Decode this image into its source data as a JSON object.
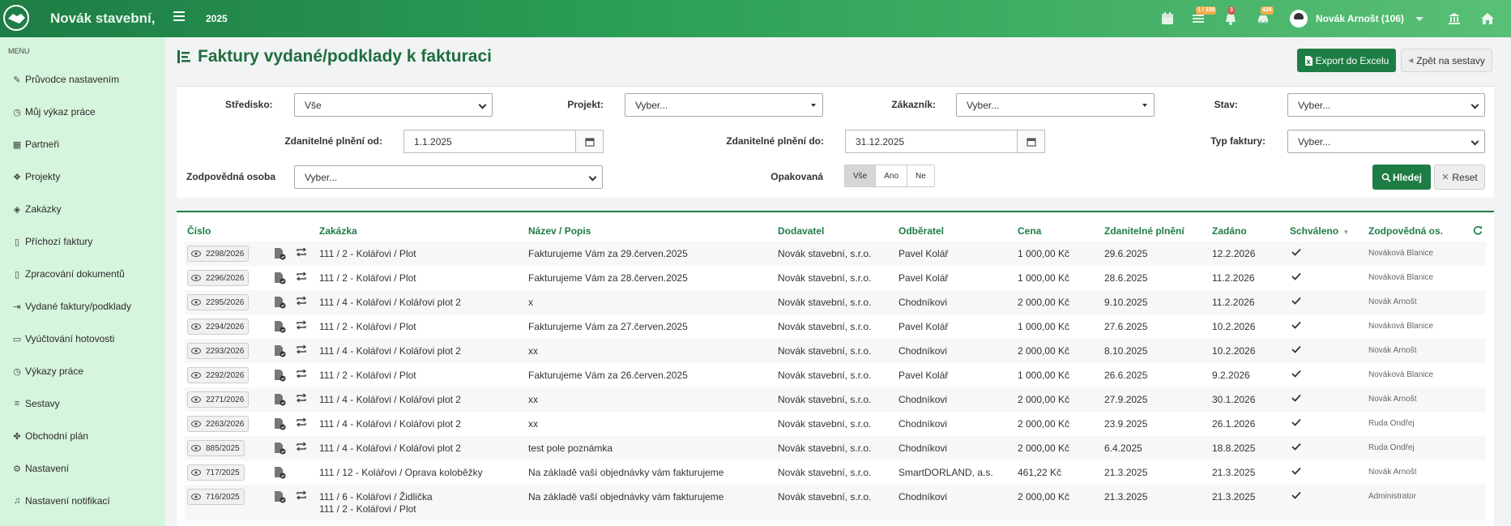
{
  "topbar": {
    "brand": "Novák stavební,",
    "year": "2025",
    "badges": {
      "tasks": "1 / 339",
      "notifications": "3",
      "cars": "428"
    },
    "user_name": "Novák Arnošt (106)"
  },
  "sidebar": {
    "menu_label": "MENU",
    "items": [
      {
        "label": "Průvodce nastavením",
        "icon": "pencil-icon"
      },
      {
        "label": "Můj výkaz práce",
        "icon": "clock-icon"
      },
      {
        "label": "Partneři",
        "icon": "building-icon"
      },
      {
        "label": "Projekty",
        "icon": "cubes-icon"
      },
      {
        "label": "Zakázky",
        "icon": "cube-icon"
      },
      {
        "label": "Příchozí faktury",
        "icon": "file-icon"
      },
      {
        "label": "Zpracování dokumentů",
        "icon": "file-icon"
      },
      {
        "label": "Vydané faktury/podklady",
        "icon": "file-export-icon"
      },
      {
        "label": "Vyúčtování hotovosti",
        "icon": "money-icon"
      },
      {
        "label": "Výkazy práce",
        "icon": "clock-icon"
      },
      {
        "label": "Sestavy",
        "icon": "list-icon"
      },
      {
        "label": "Obchodní plán",
        "icon": "handshake-icon"
      },
      {
        "label": "Nastavení",
        "icon": "cogs-icon"
      },
      {
        "label": "Nastavení notifikací",
        "icon": "bell-icon"
      }
    ]
  },
  "page": {
    "title": "Faktury vydané/podklady k fakturaci",
    "export_label": "Export do Excelu",
    "back_label": "Zpět na sestavy"
  },
  "filters": {
    "stredisko_label": "Středisko:",
    "stredisko_value": "Vše",
    "projekt_label": "Projekt:",
    "projekt_value": "Vyber...",
    "zakaznik_label": "Zákazník:",
    "zakaznik_value": "Vyber...",
    "stav_label": "Stav:",
    "stav_value": "Vyber...",
    "plneni_od_label": "Zdanitelné plnění od:",
    "plneni_od_value": "1.1.2025",
    "plneni_do_label": "Zdanitelné plnění do:",
    "plneni_do_value": "31.12.2025",
    "typ_label": "Typ faktury:",
    "typ_value": "Vyber...",
    "osoba_label": "Zodpovědná osoba",
    "osoba_value": "Vyber...",
    "opakovana_label": "Opakovaná",
    "opakovana_options": [
      "Vše",
      "Ano",
      "Ne"
    ],
    "search_label": "Hledej",
    "reset_label": "Reset"
  },
  "table": {
    "columns": [
      "Číslo",
      "Zakázka",
      "Název / Popis",
      "Dodavatel",
      "Odběratel",
      "Cena",
      "Zdanitelné plnění",
      "Zadáno",
      "Schváleno",
      "Zodpovědná os."
    ],
    "rows": [
      {
        "cislo": "2298/2026",
        "zakazka": "111 / 2 - Kolářovi / Plot",
        "nazev": "Fakturujeme Vám za 29.červen.2025",
        "dodavatel": "Novák stavební, s.r.o.",
        "odberatel": "Pavel Kolář",
        "cena": "1 000,00 Kč",
        "plneni": "29.6.2025",
        "zadano": "12.2.2026",
        "osoba": "Nováková Blanice",
        "repeat": true
      },
      {
        "cislo": "2296/2026",
        "zakazka": "111 / 2 - Kolářovi / Plot",
        "nazev": "Fakturujeme Vám za 28.červen.2025",
        "dodavatel": "Novák stavební, s.r.o.",
        "odberatel": "Pavel Kolář",
        "cena": "1 000,00 Kč",
        "plneni": "28.6.2025",
        "zadano": "11.2.2026",
        "osoba": "Nováková Blanice",
        "repeat": true
      },
      {
        "cislo": "2295/2026",
        "zakazka": "111 / 4 - Kolářovi / Kolářovi plot 2",
        "nazev": "x",
        "dodavatel": "Novák stavební, s.r.o.",
        "odberatel": "Chodníkovi",
        "cena": "2 000,00 Kč",
        "plneni": "9.10.2025",
        "zadano": "11.2.2026",
        "osoba": "Novák Arnošt",
        "repeat": true
      },
      {
        "cislo": "2294/2026",
        "zakazka": "111 / 2 - Kolářovi / Plot",
        "nazev": "Fakturujeme Vám za 27.červen.2025",
        "dodavatel": "Novák stavební, s.r.o.",
        "odberatel": "Pavel Kolář",
        "cena": "1 000,00 Kč",
        "plneni": "27.6.2025",
        "zadano": "10.2.2026",
        "osoba": "Nováková Blanice",
        "repeat": true
      },
      {
        "cislo": "2293/2026",
        "zakazka": "111 / 4 - Kolářovi / Kolářovi plot 2",
        "nazev": "xx",
        "dodavatel": "Novák stavební, s.r.o.",
        "odberatel": "Chodníkovi",
        "cena": "2 000,00 Kč",
        "plneni": "8.10.2025",
        "zadano": "10.2.2026",
        "osoba": "Novák Arnošt",
        "repeat": true
      },
      {
        "cislo": "2292/2026",
        "zakazka": "111 / 2 - Kolářovi / Plot",
        "nazev": "Fakturujeme Vám za 26.červen.2025",
        "dodavatel": "Novák stavební, s.r.o.",
        "odberatel": "Pavel Kolář",
        "cena": "1 000,00 Kč",
        "plneni": "26.6.2025",
        "zadano": "9.2.2026",
        "osoba": "Nováková Blanice",
        "repeat": true
      },
      {
        "cislo": "2271/2026",
        "zakazka": "111 / 4 - Kolářovi / Kolářovi plot 2",
        "nazev": "xx",
        "dodavatel": "Novák stavební, s.r.o.",
        "odberatel": "Chodníkovi",
        "cena": "2 000,00 Kč",
        "plneni": "27.9.2025",
        "zadano": "30.1.2026",
        "osoba": "Novák Arnošt",
        "repeat": true
      },
      {
        "cislo": "2263/2026",
        "zakazka": "111 / 4 - Kolářovi / Kolářovi plot 2",
        "nazev": "xx",
        "dodavatel": "Novák stavební, s.r.o.",
        "odberatel": "Chodníkovi",
        "cena": "2 000,00 Kč",
        "plneni": "23.9.2025",
        "zadano": "26.1.2026",
        "osoba": "Ruda Ondřej",
        "repeat": true
      },
      {
        "cislo": "885/2025",
        "zakazka": "111 / 4 - Kolářovi / Kolářovi plot 2",
        "nazev": "test pole poznámka",
        "dodavatel": "Novák stavební, s.r.o.",
        "odberatel": "Chodníkovi",
        "cena": "2 000,00 Kč",
        "plneni": "6.4.2025",
        "zadano": "18.8.2025",
        "osoba": "Ruda Ondřej",
        "repeat": true
      },
      {
        "cislo": "717/2025",
        "zakazka": "111 / 12 - Kolářovi / Oprava koloběžky",
        "nazev": "Na základě vaší objednávky vám fakturujeme",
        "dodavatel": "Novák stavební, s.r.o.",
        "odberatel": "SmartDORLAND, a.s.",
        "cena": "461,22 Kč",
        "plneni": "21.3.2025",
        "zadano": "21.3.2025",
        "osoba": "Novák Arnošt",
        "repeat": false
      },
      {
        "cislo": "716/2025",
        "zakazka": "111 / 6 - Kolářovi / Židlička",
        "zakazka2": "111 / 2 - Kolářovi / Plot",
        "nazev": "Na základě vaší objednávky vám fakturujeme",
        "dodavatel": "Novák stavební, s.r.o.",
        "odberatel": "Chodníkovi",
        "cena": "2 000,00 Kč",
        "plneni": "21.3.2025",
        "zadano": "21.3.2025",
        "osoba": "Administrator",
        "repeat": true
      }
    ]
  }
}
